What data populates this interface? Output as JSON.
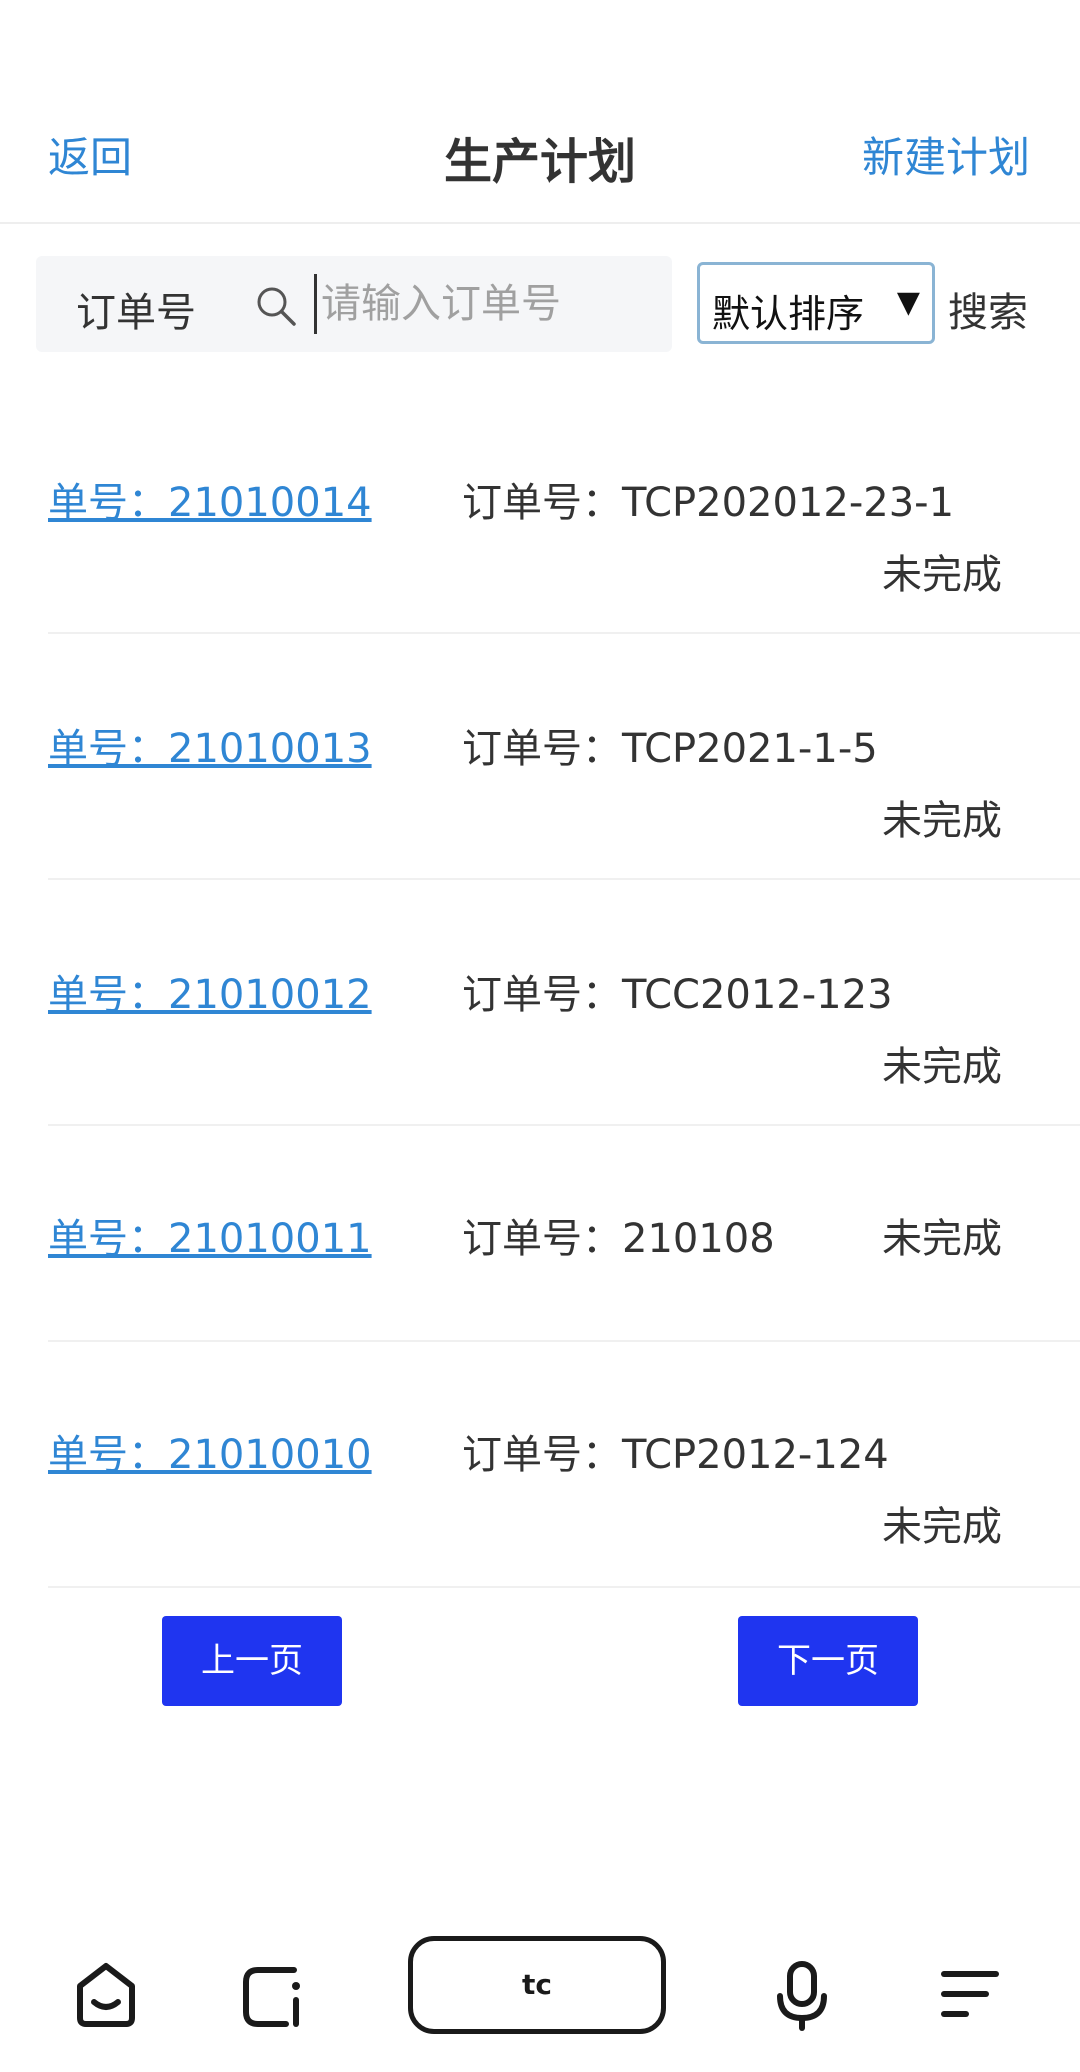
{
  "header": {
    "back_label": "返回",
    "title": "生产计划",
    "new_plan_label": "新建计划"
  },
  "search": {
    "label": "订单号",
    "placeholder": "请输入订单号",
    "sort_selected": "默认排序",
    "button_label": "搜索"
  },
  "items": [
    {
      "id_label": "单号：21010014",
      "order_label": "订单号：TCP202012-23-1",
      "status": "未完成"
    },
    {
      "id_label": "单号：21010013",
      "order_label": "订单号：TCP2021-1-5",
      "status": "未完成"
    },
    {
      "id_label": "单号：21010012",
      "order_label": "订单号：TCC2012-123",
      "status": "未完成"
    },
    {
      "id_label": "单号：21010011",
      "order_label": "订单号：210108",
      "status": "未完成"
    },
    {
      "id_label": "单号：21010010",
      "order_label": "订单号：TCP2012-124",
      "status": "未完成"
    }
  ],
  "pager": {
    "prev_label": "上一页",
    "next_label": "下一页"
  },
  "navbar": {
    "center_label": "tc",
    "icons": [
      "home-icon",
      "recent-apps-icon",
      "microphone-icon",
      "menu-icon"
    ]
  },
  "colors": {
    "link": "#2f86d4",
    "pager_button": "#1f35f0"
  }
}
